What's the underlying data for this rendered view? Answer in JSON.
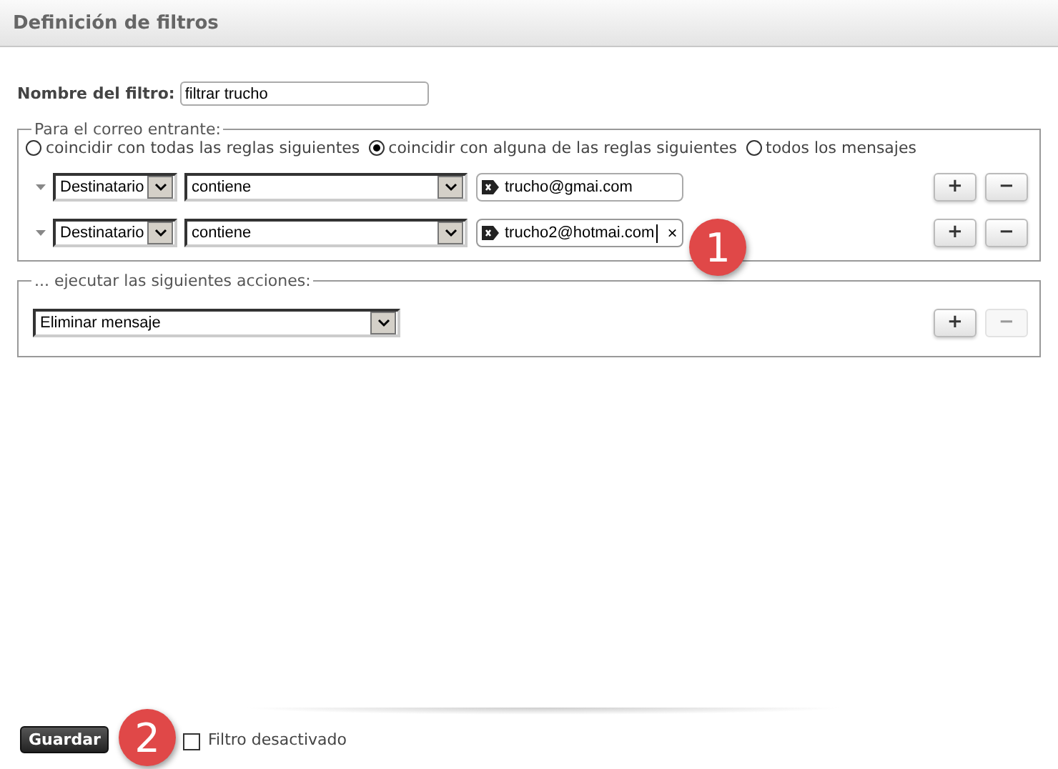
{
  "header": {
    "title": "Definición de filtros"
  },
  "filter_name": {
    "label": "Nombre del filtro:",
    "value": "filtrar trucho"
  },
  "incoming": {
    "legend": "Para el correo entrante:",
    "match_options": [
      {
        "label": "coincidir con todas las reglas siguientes",
        "selected": false
      },
      {
        "label": "coincidir con alguna de las reglas siguientes",
        "selected": true
      },
      {
        "label": "todos los mensajes",
        "selected": false
      }
    ],
    "rules": [
      {
        "field": "Destinatario",
        "operator": "contiene",
        "value": "trucho@gmai.com",
        "focused": false,
        "add": "+",
        "remove": "−",
        "remove_disabled": false
      },
      {
        "field": "Destinatario",
        "operator": "contiene",
        "value": "trucho2@hotmai.com",
        "clear": "×",
        "focused": true,
        "add": "+",
        "remove": "−",
        "remove_disabled": false
      }
    ]
  },
  "actions": {
    "legend": "... ejecutar las siguientes acciones:",
    "rows": [
      {
        "action": "Eliminar mensaje",
        "add": "+",
        "remove": "−",
        "remove_disabled": true
      }
    ]
  },
  "footer": {
    "save": "Guardar",
    "disabled_label": "Filtro desactivado",
    "disabled_checked": false
  },
  "callouts": [
    "1",
    "2"
  ]
}
